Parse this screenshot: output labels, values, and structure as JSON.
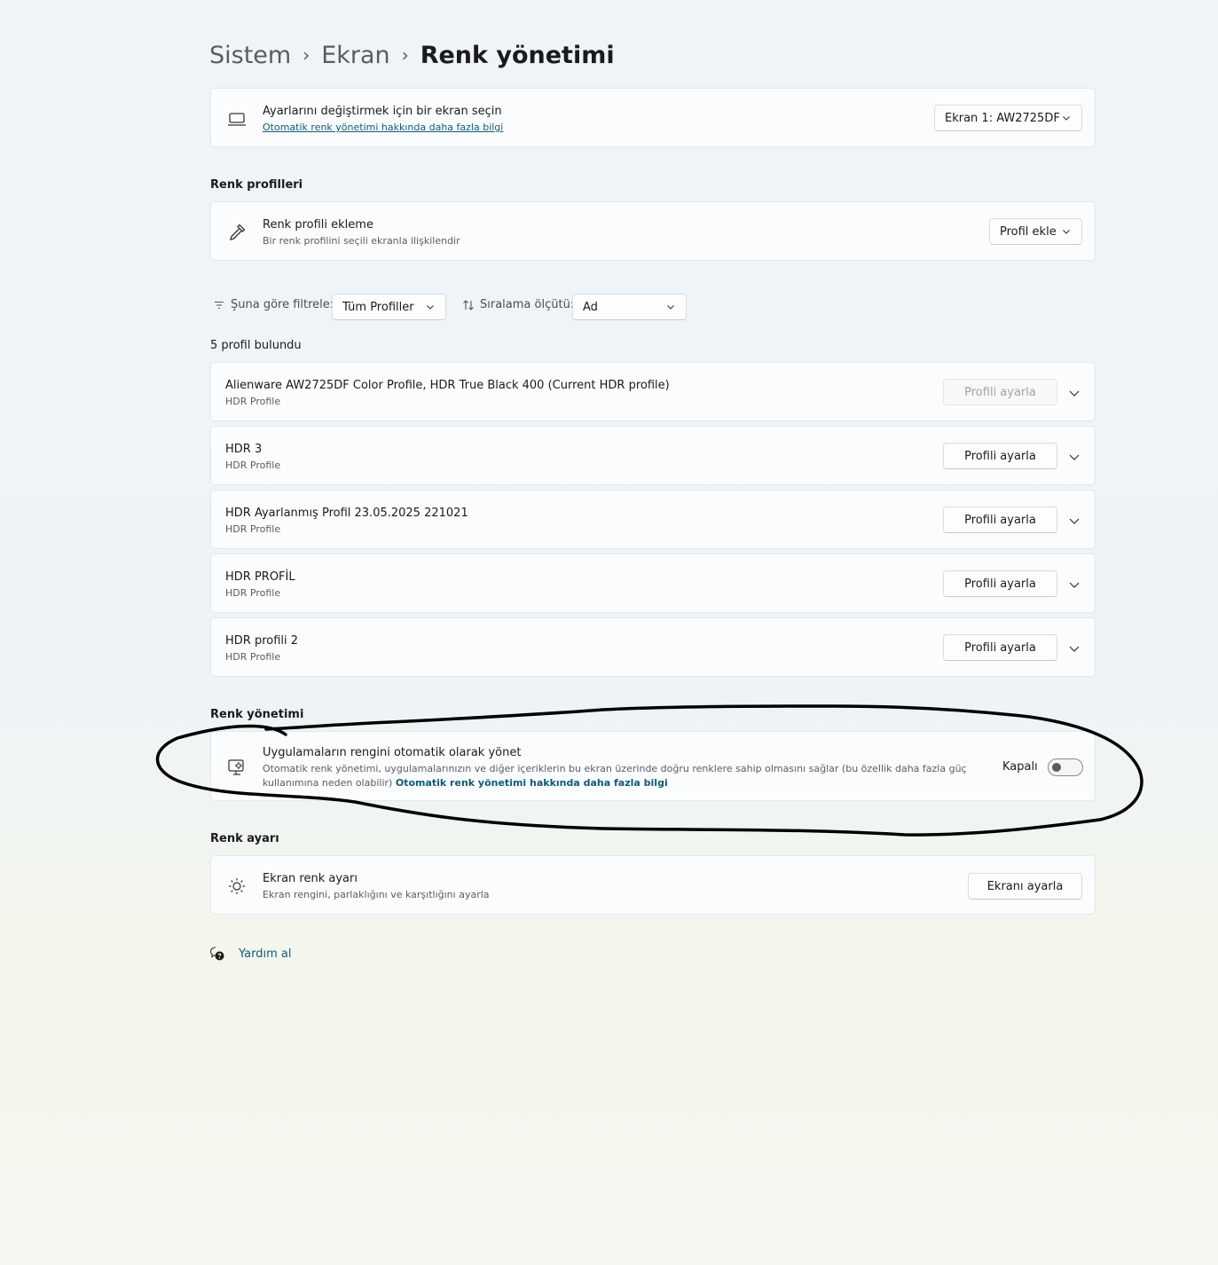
{
  "breadcrumb": {
    "items": [
      "Sistem",
      "Ekran"
    ],
    "current": "Renk yönetimi",
    "separator": "›"
  },
  "display_select": {
    "title": "Ayarlarını değiştirmek için bir ekran seçin",
    "link": "Otomatik renk yönetimi hakkında daha fazla bilgi",
    "dropdown_value": "Ekran 1: AW2725DF"
  },
  "profiles_section": {
    "heading": "Renk profilleri",
    "add_title": "Renk profili ekleme",
    "add_subtitle": "Bir renk profilini seçili ekranla ilişkilendir",
    "add_button": "Profil ekle"
  },
  "filter": {
    "filter_label": "Şuna göre filtrele:",
    "filter_value": "Tüm Profiller",
    "sort_label": "Sıralama ölçütü:",
    "sort_value": "Ad"
  },
  "profiles_found": "5 profil bulundu",
  "profiles": [
    {
      "name": "Alienware AW2725DF Color Profile, HDR True Black 400 (Current HDR profile)",
      "type": "HDR Profile",
      "button": "Profili ayarla",
      "disabled": true
    },
    {
      "name": "HDR 3",
      "type": "HDR Profile",
      "button": "Profili ayarla",
      "disabled": false
    },
    {
      "name": "HDR Ayarlanmış Profil 23.05.2025 221021",
      "type": "HDR Profile",
      "button": "Profili ayarla",
      "disabled": false
    },
    {
      "name": "HDR PROFİL",
      "type": "HDR Profile",
      "button": "Profili ayarla",
      "disabled": false
    },
    {
      "name": "HDR profili 2",
      "type": "HDR Profile",
      "button": "Profili ayarla",
      "disabled": false
    }
  ],
  "color_management": {
    "heading": "Renk yönetimi",
    "title": "Uygulamaların rengini otomatik olarak yönet",
    "desc_line1": "Otomatik renk yönetimi, uygulamalarınızın ve diğer içeriklerin bu ekran üzerinde doğru renklere sahip olmasını sağlar (bu özellik daha fazla güç",
    "desc_line2": "kullanımına neden olabilir)",
    "desc_link": "Otomatik renk yönetimi hakkında daha fazla bilgi",
    "toggle_label": "Kapalı",
    "toggle_on": false
  },
  "calibration": {
    "heading": "Renk ayarı",
    "title": "Ekran renk ayarı",
    "subtitle": "Ekran rengini, parlaklığını ve karşıtlığını ayarla",
    "button": "Ekranı ayarla"
  },
  "help": {
    "label": "Yardım al"
  },
  "icons": [
    "laptop-icon",
    "eyedropper-icon",
    "filter-icon",
    "sort-icon",
    "chevron-down-icon",
    "monitor-color-icon",
    "brightness-icon",
    "help-icon"
  ],
  "colors": {
    "link": "#0f5a79",
    "annotation": "#000000"
  }
}
